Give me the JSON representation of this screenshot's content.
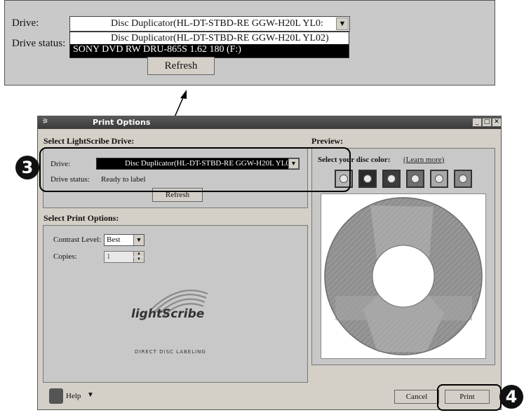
{
  "zoom": {
    "drive_label": "Drive:",
    "drive_value": "Disc Duplicator(HL-DT-STBD-RE  GGW-H20L YL0:",
    "status_label": "Drive status:",
    "options": [
      "Disc Duplicator(HL-DT-STBD-RE  GGW-H20L YL02)",
      "SONY DVD RW DRU-865S 1.62 180 (F:)"
    ],
    "refresh_label": "Refresh"
  },
  "dialog": {
    "title": "Print Options",
    "select_drive_heading": "Select LightScribe Drive:",
    "drive_label": "Drive:",
    "drive_value": "Disc Duplicator(HL-DT-STBD-RE  GGW-H20L YL0:",
    "status_label": "Drive status:",
    "status_value": "Ready to label",
    "refresh_label": "Refresh",
    "print_options_heading": "Select Print Options:",
    "contrast_label": "Contrast Level:",
    "contrast_value": "Best",
    "copies_label": "Copies:",
    "copies_value": "1",
    "logo_text": "lightScribe",
    "logo_tagline": "DIRECT DISC LABELING",
    "preview_heading": "Preview:",
    "disc_color_label": "Select your disc color:",
    "learn_more_link": "(Learn more)",
    "help_label": "Help",
    "cancel_label": "Cancel",
    "print_label": "Print"
  },
  "markers": {
    "step3": "3",
    "step4": "4"
  },
  "colors": {
    "swatches": [
      "#b5b5b5",
      "#2a2a2a",
      "#3c3c3c",
      "#6e6e6e",
      "#a9a9a9",
      "#8a8a8a"
    ],
    "disc": "#8f8f8f"
  }
}
